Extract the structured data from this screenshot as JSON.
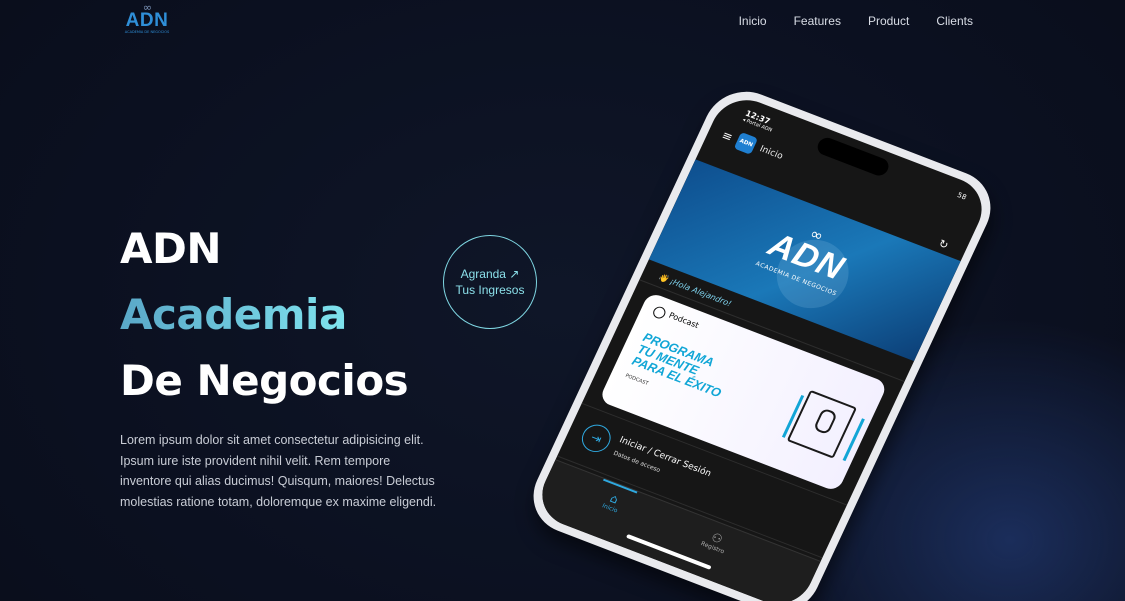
{
  "nav": {
    "logo": {
      "symbol": "∞",
      "brand": "ADN",
      "tagline": "ACADEMIA DE NEGOCIOS"
    },
    "links": [
      "Inicio",
      "Features",
      "Product",
      "Clients"
    ]
  },
  "hero": {
    "line1": "ADN",
    "line2": "Academia",
    "line3": "De Negocios",
    "description": "Lorem ipsum dolor sit amet consectetur adipisicing elit. Ipsum iure iste provident nihil velit. Rem tempore inventore qui alias ducimus! Quisqum, maiores! Delectus molestias ratione totam, doloremque ex maxime eligendi."
  },
  "cta": {
    "line1": "Agranda ↗",
    "line2": "Tus Ingresos"
  },
  "phone": {
    "time": "12:37",
    "back_label": "◂ Portal ADN",
    "battery": "58",
    "app_icon": "ADN",
    "app_title": "Inicio",
    "banner": {
      "symbol": "∞",
      "brand": "ADN",
      "tagline": "ACADEMIA DE NEGOCIOS"
    },
    "greeting": "👋 ¡Hola Alejandro!",
    "podcast_label": "Podcast",
    "podcast_title": [
      "PROGRAMA",
      "TU MENTE",
      "PARA EL ÉXITO"
    ],
    "podcast_sub": "PODCAST",
    "login_title": "Iniciar / Cerrar Sesión",
    "login_sub": "Datos de acceso",
    "tabs": [
      "Inicio",
      "Registro"
    ]
  },
  "colors": {
    "background": "#0b1020",
    "accent": "#7fe3ee",
    "brand_blue": "#2f8fd8"
  },
  "icons": [
    "infinity-icon",
    "arrow-up-right-icon",
    "hamburger-icon",
    "refresh-icon",
    "podcast-icon",
    "microphone-icon",
    "login-icon",
    "home-icon",
    "add-user-icon"
  ]
}
